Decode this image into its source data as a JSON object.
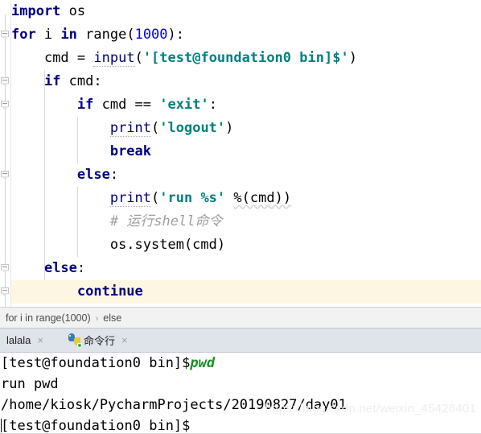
{
  "editor": {
    "lines": [
      {
        "indent": 0,
        "highlight": false,
        "tokens": [
          {
            "t": "import",
            "c": "kw"
          },
          {
            "t": " ",
            "c": "plain"
          },
          {
            "t": "os",
            "c": "plain"
          }
        ]
      },
      {
        "indent": 0,
        "highlight": false,
        "tokens": [
          {
            "t": "for",
            "c": "kw"
          },
          {
            "t": " i ",
            "c": "plain"
          },
          {
            "t": "in",
            "c": "kw"
          },
          {
            "t": " range(",
            "c": "plain"
          },
          {
            "t": "1000",
            "c": "num"
          },
          {
            "t": "):",
            "c": "plain"
          }
        ]
      },
      {
        "indent": 1,
        "highlight": false,
        "tokens": [
          {
            "t": "cmd = ",
            "c": "plain"
          },
          {
            "t": "input",
            "c": "fn"
          },
          {
            "t": "(",
            "c": "plain"
          },
          {
            "t": "'[test@foundation0 bin]$'",
            "c": "str"
          },
          {
            "t": ")",
            "c": "plain"
          }
        ]
      },
      {
        "indent": 1,
        "highlight": false,
        "tokens": [
          {
            "t": "if",
            "c": "kw"
          },
          {
            "t": " cmd:",
            "c": "plain"
          }
        ]
      },
      {
        "indent": 2,
        "highlight": false,
        "tokens": [
          {
            "t": "if",
            "c": "kw"
          },
          {
            "t": " cmd == ",
            "c": "plain"
          },
          {
            "t": "'exit'",
            "c": "str"
          },
          {
            "t": ":",
            "c": "plain"
          }
        ]
      },
      {
        "indent": 3,
        "highlight": false,
        "tokens": [
          {
            "t": "print",
            "c": "fn"
          },
          {
            "t": "(",
            "c": "plain"
          },
          {
            "t": "'logout'",
            "c": "str"
          },
          {
            "t": ")",
            "c": "plain"
          }
        ]
      },
      {
        "indent": 3,
        "highlight": false,
        "tokens": [
          {
            "t": "break",
            "c": "kw"
          }
        ]
      },
      {
        "indent": 2,
        "highlight": false,
        "tokens": [
          {
            "t": "else",
            "c": "kw"
          },
          {
            "t": ":",
            "c": "plain"
          }
        ]
      },
      {
        "indent": 3,
        "highlight": false,
        "tokens": [
          {
            "t": "print",
            "c": "fn"
          },
          {
            "t": "(",
            "c": "plain"
          },
          {
            "t": "'run %s'",
            "c": "str"
          },
          {
            "t": " ",
            "c": "plain"
          },
          {
            "t": "%(cmd))",
            "c": "wavy"
          }
        ]
      },
      {
        "indent": 3,
        "highlight": false,
        "tokens": [
          {
            "t": "# 运行shell命令",
            "c": "cmt"
          }
        ]
      },
      {
        "indent": 3,
        "highlight": false,
        "tokens": [
          {
            "t": "os.system(cmd)",
            "c": "plain"
          }
        ]
      },
      {
        "indent": 1,
        "highlight": false,
        "tokens": [
          {
            "t": "else",
            "c": "kw"
          },
          {
            "t": ":",
            "c": "plain"
          }
        ]
      },
      {
        "indent": 2,
        "highlight": true,
        "tokens": [
          {
            "t": "continue",
            "c": "kw"
          }
        ]
      }
    ],
    "fold_marker_lines": [
      1,
      3,
      4,
      7,
      11,
      12
    ],
    "indent_guides": [
      {
        "level": 1,
        "from_line": 3,
        "to_line": 12
      },
      {
        "level": 2,
        "from_line": 5,
        "to_line": 6
      },
      {
        "level": 2,
        "from_line": 8,
        "to_line": 10
      }
    ]
  },
  "breadcrumb": {
    "items": [
      "for i in range(1000)",
      "else"
    ],
    "separator": "›"
  },
  "tabs": [
    {
      "label": "lalala",
      "icon": null,
      "close": "×",
      "active": false
    },
    {
      "label": "命令行",
      "icon": "python-icon",
      "close": "×",
      "active": true
    }
  ],
  "console": {
    "lines": [
      {
        "prompt": "[test@foundation0 bin]$",
        "input": "pwd",
        "caret": false
      },
      {
        "prompt": "run pwd",
        "input": "",
        "caret": false
      },
      {
        "prompt": "/home/kiosk/PycharmProjects/20190827/day01",
        "input": "",
        "caret": false
      },
      {
        "prompt": "[test@foundation0 bin]$",
        "input": "",
        "caret": true
      }
    ]
  },
  "watermark": "https://blog.csdn.net/weixin_45426401",
  "colors": {
    "keyword": "#000080",
    "number": "#0000ff",
    "string": "#008080",
    "comment": "#a0a0a0",
    "highlight_line": "#fdf6e3",
    "tabbar_bg": "#dfe3ea",
    "breadcrumb_bg": "#f2f2f2",
    "console_input": "#1a9023"
  }
}
